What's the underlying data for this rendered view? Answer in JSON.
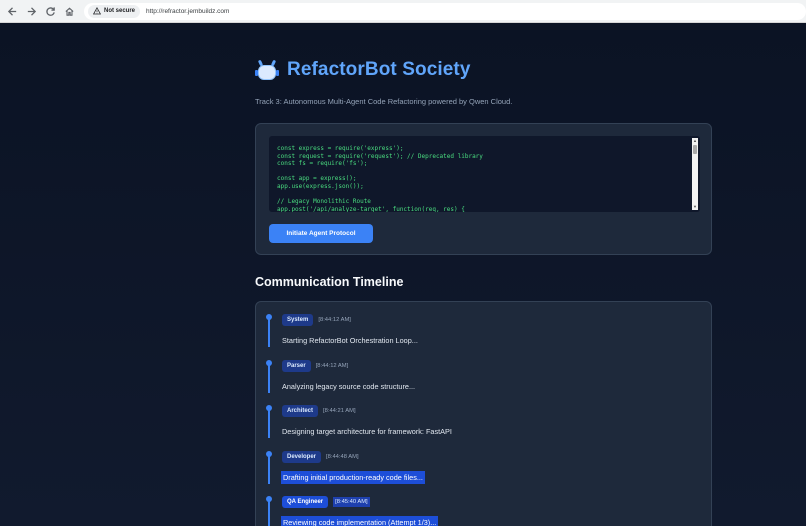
{
  "browser": {
    "security_label": "Not secure",
    "url": "http://refractor.jembuildz.com"
  },
  "header": {
    "title": "RefactorBot Society",
    "subtitle": "Track 3: Autonomous Multi-Agent Code Refactoring powered by Qwen Cloud."
  },
  "editor": {
    "code_lines": [
      "const express = require('express');",
      "const request = require('request'); // Deprecated library",
      "const fs = require('fs');",
      "",
      "const app = express();",
      "app.use(express.json());",
      "",
      "// Legacy Monolithic Route",
      "app.post('/api/analyze-target', function(req, res) {"
    ],
    "button_label": "Initiate Agent Protocol"
  },
  "timeline": {
    "title": "Communication Timeline",
    "entries": [
      {
        "agent": "System",
        "time": "[8:44:12 AM]",
        "message": "Starting RefactorBot Orchestration Loop..."
      },
      {
        "agent": "Parser",
        "time": "[8:44:12 AM]",
        "message": "Analyzing legacy source code structure..."
      },
      {
        "agent": "Architect",
        "time": "[8:44:21 AM]",
        "message": "Designing target architecture for framework: FastAPI"
      },
      {
        "agent": "Developer",
        "time": "[8:44:48 AM]",
        "message": "Drafting initial production-ready code files..."
      },
      {
        "agent": "QA Engineer",
        "time": "[8:45:40 AM]",
        "message": "Reviewing code implementation (Attempt 1/3)..."
      }
    ]
  },
  "colors": {
    "accent": "#3b82f6",
    "title": "#60a5fa",
    "code": "#4ade80",
    "background": "#0f172a",
    "card": "#1e293b"
  },
  "icons": {
    "back": "arrow-left-icon",
    "forward": "arrow-right-icon",
    "reload": "reload-icon",
    "home": "home-icon",
    "warning": "warning-triangle-icon",
    "logo": "robot-icon"
  }
}
